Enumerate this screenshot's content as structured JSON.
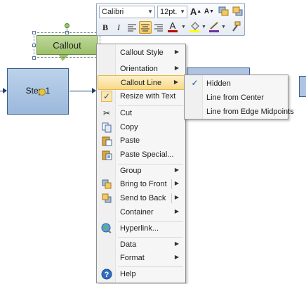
{
  "canvas": {
    "process_label": "Step 1",
    "callout_label": "Callout"
  },
  "mini_toolbar": {
    "font_name": "Calibri",
    "font_size": "12pt."
  },
  "context_menu": {
    "items": [
      {
        "label": "Callout Style",
        "icon": "",
        "submenu": true
      },
      {
        "label": "Orientation",
        "icon": "",
        "submenu": true
      },
      {
        "label": "Callout Line",
        "icon": "",
        "submenu": true,
        "highlighted": true
      },
      {
        "label": "Resize with Text",
        "icon": "check-icon",
        "checked": true
      },
      {
        "label": "Cut",
        "icon": "cut-icon"
      },
      {
        "label": "Copy",
        "icon": "copy-icon"
      },
      {
        "label": "Paste",
        "icon": "paste-icon"
      },
      {
        "label": "Paste Special...",
        "icon": "paste-special-icon"
      },
      {
        "label": "Group",
        "icon": "",
        "submenu": true
      },
      {
        "label": "Bring to Front",
        "icon": "bring-front-icon",
        "submenu": true
      },
      {
        "label": "Send to Back",
        "icon": "send-back-icon",
        "submenu": true
      },
      {
        "label": "Container",
        "icon": "",
        "submenu": true
      },
      {
        "label": "Hyperlink...",
        "icon": "hyperlink-icon"
      },
      {
        "label": "Data",
        "icon": "",
        "submenu": true
      },
      {
        "label": "Format",
        "icon": "",
        "submenu": true
      },
      {
        "label": "Help",
        "icon": "help-icon"
      }
    ]
  },
  "submenu": {
    "items": [
      {
        "label": "Hidden",
        "checked": true
      },
      {
        "label": "Line from Center"
      },
      {
        "label": "Line from Edge Midpoints"
      }
    ]
  },
  "colors": {
    "font_color": "#c00000",
    "fill_color": "#ffff00",
    "line_color": "#7030a0",
    "menu_highlight": "#f7d98a"
  }
}
